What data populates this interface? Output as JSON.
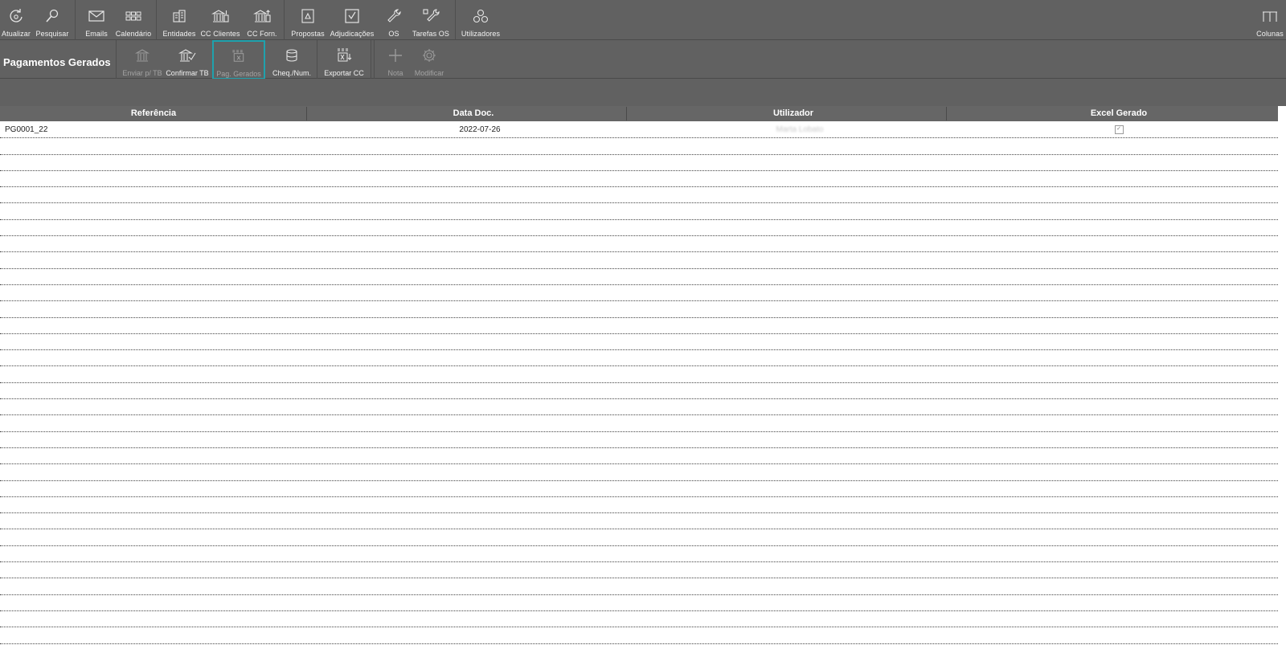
{
  "toolbar": {
    "items": [
      {
        "label": "Atualizar",
        "icon": "refresh-icon"
      },
      {
        "label": "Pesquisar",
        "icon": "search-icon"
      },
      {
        "label": "Emails",
        "icon": "envelope-icon"
      },
      {
        "label": "Calendário",
        "icon": "calendar-grid-icon"
      },
      {
        "label": "Entidades",
        "icon": "entities-icon"
      },
      {
        "label": "CC Clientes",
        "icon": "bank-client-icon"
      },
      {
        "label": "CC Forn.",
        "icon": "bank-supplier-icon"
      },
      {
        "label": "Propostas",
        "icon": "proposal-icon"
      },
      {
        "label": "Adjudicações",
        "icon": "checkbox-icon"
      },
      {
        "label": "OS",
        "icon": "wrench-icon"
      },
      {
        "label": "Tarefas OS",
        "icon": "tasks-wrench-icon"
      },
      {
        "label": "Utilizadores",
        "icon": "users-icon"
      },
      {
        "label": "Colunas",
        "icon": "columns-icon"
      }
    ]
  },
  "page": {
    "title": "Pagamentos Gerados"
  },
  "actions": {
    "items": [
      {
        "label": "Enviar p/ TB",
        "icon": "bank-send-icon",
        "enabled": false
      },
      {
        "label": "Confirmar TB",
        "icon": "bank-confirm-icon",
        "enabled": true
      },
      {
        "label": "Pag. Gerados",
        "icon": "excel-generated-icon",
        "enabled": false,
        "selected": true
      },
      {
        "label": "Cheq./Num.",
        "icon": "database-icon",
        "enabled": true
      },
      {
        "label": "Exportar CC",
        "icon": "excel-export-icon",
        "enabled": true
      },
      {
        "label": "Nota",
        "icon": "plus-icon",
        "enabled": false
      },
      {
        "label": "Modificar",
        "icon": "gear-icon",
        "enabled": false
      }
    ]
  },
  "table": {
    "columns": [
      "Referência",
      "Data Doc.",
      "Utilizador",
      "Excel Gerado"
    ],
    "rows": [
      {
        "referencia": "PG0001_22",
        "data_doc": "2022-07-26",
        "utilizador": "Marta Lobato",
        "excel_gerado": true
      }
    ]
  },
  "colors": {
    "toolbar_bg": "#616161",
    "selected_border": "#1fa2ad",
    "header_bg": "#666666"
  }
}
